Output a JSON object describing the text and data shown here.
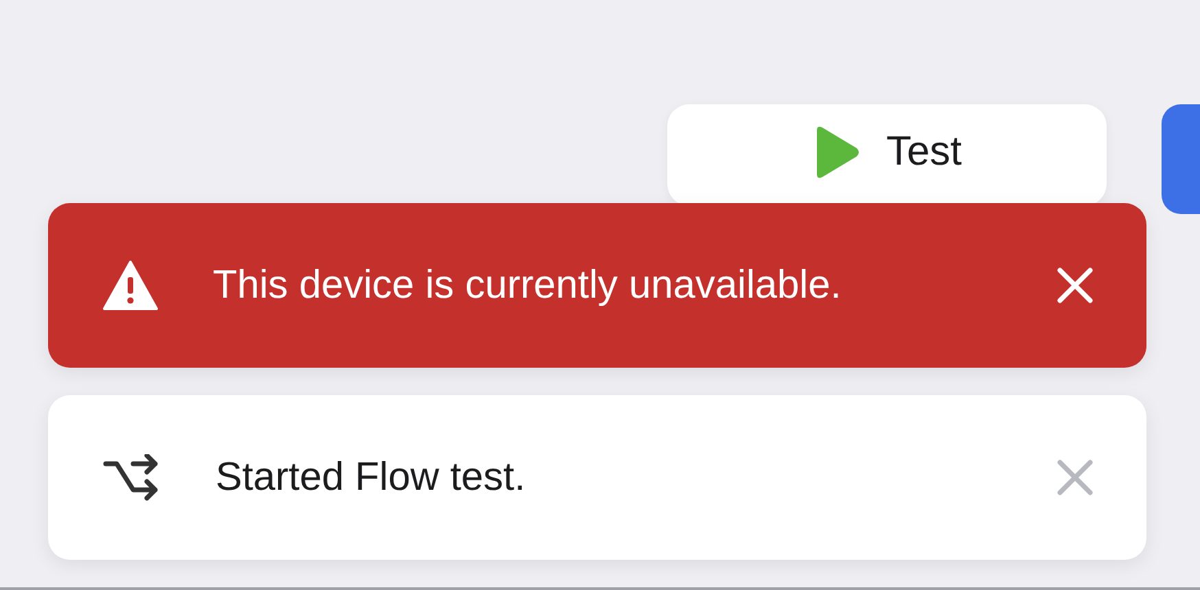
{
  "toolbar": {
    "test_button": {
      "label": "Test"
    }
  },
  "toasts": [
    {
      "kind": "error",
      "message": "This device is currently unavailable."
    },
    {
      "kind": "info",
      "message": "Started Flow test."
    }
  ]
}
